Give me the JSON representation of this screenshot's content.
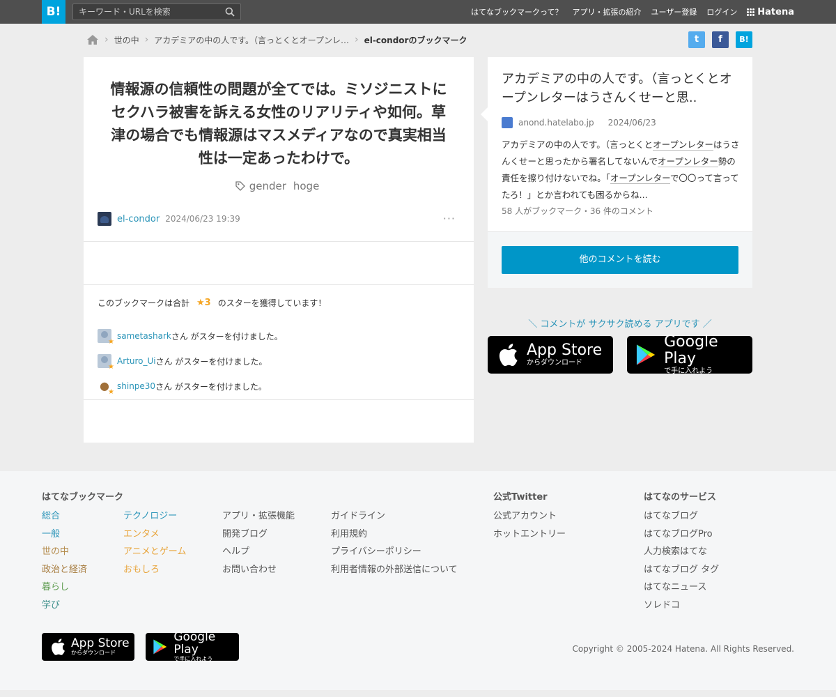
{
  "header": {
    "logo_text": "B!",
    "search_placeholder": "キーワード・URLを検索",
    "nav": [
      "はてなブックマークって？",
      "アプリ・拡張の紹介",
      "ユーザー登録",
      "ログイン"
    ],
    "brand": "Hatena"
  },
  "breadcrumb": {
    "items": [
      "世の中",
      "アカデミアの中の人です。（言っとくとオープンレ…"
    ],
    "current": "el-condorのブックマーク"
  },
  "share": {
    "twitter": "t",
    "facebook": "f",
    "hatena": "B!"
  },
  "bookmark": {
    "comment": "情報源の信頼性の問題が全てでは。ミソジニストにセクハラ被害を訴える女性のリアリティや如何。草津の場合でも情報源はマスメディアなので真実相当性は一定あったわけで。",
    "tags": [
      "gender",
      "hoge"
    ],
    "user": "el-condor",
    "timestamp": "2024/06/23 19:39",
    "more": "···"
  },
  "stars": {
    "prefix": "このブックマークは合計",
    "count": "★3",
    "suffix": "のスターを獲得しています！",
    "users": [
      {
        "name": "sametashark",
        "text": "さん がスターを付けました。"
      },
      {
        "name": "Arturo_Ui",
        "text": "さん がスターを付けました。"
      },
      {
        "name": "shinpe30",
        "text": "さん がスターを付けました。"
      }
    ]
  },
  "entry": {
    "title": "アカデミアの中の人です。（言っとくとオープンレターはうさんくせーと思..",
    "domain": "anond.hatelabo.jp",
    "date": "2024/06/23",
    "summary": {
      "p1": "アカデミアの中の人です。（言っとくと",
      "k1": "オープンレター",
      "p2": "はうさんくせーと思ったから署名してないんで",
      "k2": "オープンレター",
      "p3": "勢の責任を擦り付けないでね。「",
      "k3": "オープンレター",
      "p4": "で〇〇って言ってたろ！」とか言われても困るからね..."
    },
    "counts": "58 人がブックマーク・36 件のコメント",
    "read_button": "他のコメントを読む"
  },
  "promo": {
    "text": "＼ コメントが サクサク読める アプリです ／",
    "appstore_main": "App Store",
    "appstore_sub": "からダウンロード",
    "gplay_main": "Google Play",
    "gplay_sub": "で手に入れよう"
  },
  "footer": {
    "head_bookmark": "はてなブックマーク",
    "head_twitter": "公式Twitter",
    "head_services": "はてなのサービス",
    "categories_1": [
      "総合",
      "一般",
      "世の中",
      "政治と経済",
      "暮らし",
      "学び"
    ],
    "categories_2": [
      "テクノロジー",
      "エンタメ",
      "アニメとゲーム",
      "おもしろ"
    ],
    "links_1": [
      "アプリ・拡張機能",
      "開発ブログ",
      "ヘルプ",
      "お問い合わせ"
    ],
    "links_2": [
      "ガイドライン",
      "利用規約",
      "プライバシーポリシー",
      "利用者情報の外部送信について"
    ],
    "twitter_links": [
      "公式アカウント",
      "ホットエントリー"
    ],
    "services": [
      "はてなブログ",
      "はてなブログPro",
      "人力検索はてな",
      "はてなブログ タグ",
      "はてなニュース",
      "ソレドコ"
    ],
    "copyright": "Copyright © 2005-2024 Hatena. All Rights Reserved."
  },
  "colors": {
    "brand": "#00a4de",
    "button": "#0096c8",
    "link": "#2a94b8",
    "star": "#f5a623"
  }
}
